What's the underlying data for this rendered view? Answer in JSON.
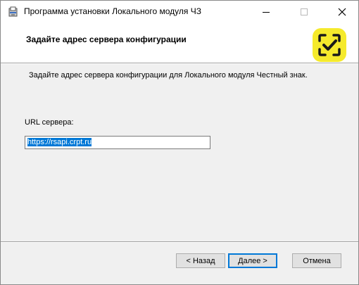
{
  "window": {
    "title": "Программа установки Локального модуля ЧЗ"
  },
  "banner": {
    "title": "Задайте адрес сервера конфигурации"
  },
  "body": {
    "description": "Задайте адрес сервера конфигурации для Локального модуля Честный знак.",
    "url_label": "URL сервера:",
    "url_value": "https://rsapi.crpt.ru"
  },
  "buttons": {
    "back": "< Назад",
    "next": "Далее >",
    "cancel": "Отмена"
  },
  "colors": {
    "logo_yellow": "#f5ea2c",
    "selection_blue": "#0078d7"
  },
  "icons": {
    "app": "installer-icon",
    "minimize": "minimize-icon",
    "maximize": "maximize-icon",
    "close": "close-icon",
    "logo": "chestny-znak-logo"
  }
}
